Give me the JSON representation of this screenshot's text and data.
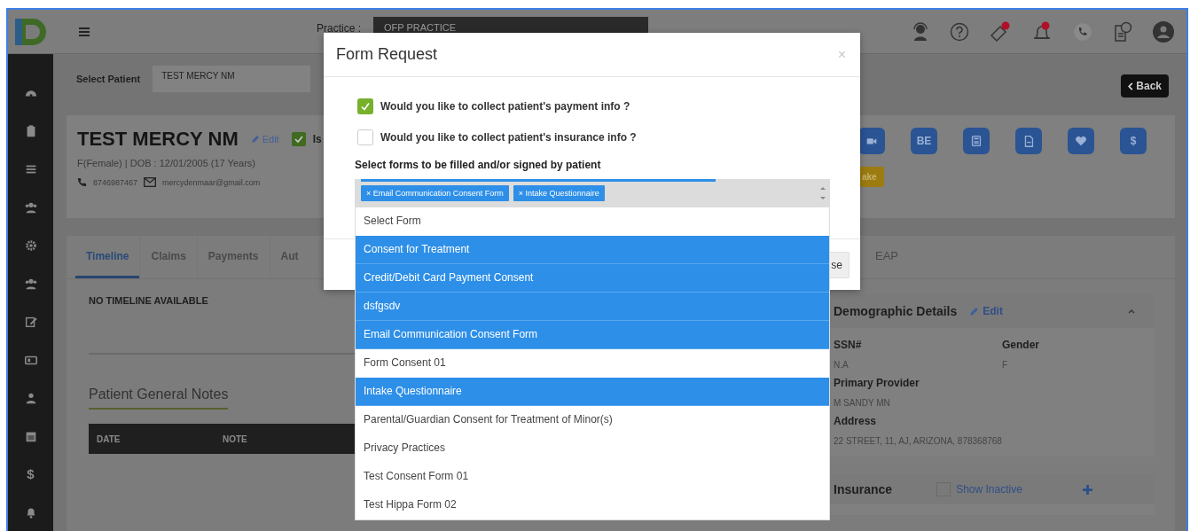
{
  "header": {
    "practice_label": "Practice :",
    "practice_value": "OFP PRACTICE"
  },
  "sidebar": {
    "items": [
      {
        "kind": "dashboard"
      },
      {
        "kind": "clipboard"
      },
      {
        "kind": "list"
      },
      {
        "kind": "users"
      },
      {
        "kind": "settings"
      },
      {
        "kind": "users"
      },
      {
        "kind": "edit"
      },
      {
        "kind": "card"
      },
      {
        "kind": "person"
      },
      {
        "kind": "calendar"
      },
      {
        "kind": "text",
        "label": "$"
      },
      {
        "kind": "bell"
      }
    ]
  },
  "patient_select": {
    "label": "Select Patient",
    "value": "TEST MERCY NM"
  },
  "back_button": "Back",
  "patient": {
    "name": "TEST MERCY NM",
    "edit": "Edit",
    "active_label": "Is",
    "active_checked": true,
    "summary": "F(Female) | DOB : 12/01/2005 (17 Years)",
    "phone": "8746987467",
    "email": "mercydenmaar@gmail.com"
  },
  "action_buttons": [
    {
      "kind": "video"
    },
    {
      "kind": "text",
      "label": "BE"
    },
    {
      "kind": "calculator"
    },
    {
      "kind": "document"
    },
    {
      "kind": "heart"
    },
    {
      "kind": "text",
      "label": "$"
    }
  ],
  "status_button": "ake",
  "tabs": [
    {
      "label": "Timeline",
      "selected": true
    },
    {
      "label": "Claims",
      "selected": false
    },
    {
      "label": "Payments",
      "selected": false
    },
    {
      "label": "Aut",
      "selected": false
    }
  ],
  "right_tab": {
    "label": "EAP",
    "selected": false
  },
  "timeline": {
    "empty_text": "NO TIMELINE AVAILABLE"
  },
  "notes": {
    "title": "Patient General Notes",
    "columns": [
      "DATE",
      "NOTE"
    ]
  },
  "demographics": {
    "title": "Demographic Details",
    "edit": "Edit",
    "expanded": true,
    "fields": [
      {
        "label": "SSN#",
        "value": "N.A"
      },
      {
        "label": "Gender",
        "value": "F"
      },
      {
        "label": "Primary Provider",
        "value": "M SANDY MN"
      },
      {
        "label": "Address",
        "value": "22 STREET, 11, AJ, ARIZONA, 878368768"
      }
    ]
  },
  "insurance": {
    "title": "Insurance",
    "show_inactive": {
      "label": "Show Inactive",
      "checked": false
    }
  },
  "modal": {
    "title": "Form Request",
    "close": "×",
    "questions": [
      {
        "label": "Would you like to collect patient's payment info ?",
        "checked": true
      },
      {
        "label": "Would you like to collect patient's insurance info ?",
        "checked": false
      }
    ],
    "forms_label": "Select forms to be filled and/or signed by patient",
    "tags": [
      {
        "label": "Email Communication Consent Form",
        "remove": "×"
      },
      {
        "label": "Intake Questionnaire",
        "remove": "×"
      }
    ],
    "options": [
      {
        "label": "Select Form",
        "selected": false
      },
      {
        "label": "Consent for Treatment",
        "selected": true
      },
      {
        "label": "Credit/Debit Card Payment Consent",
        "selected": true
      },
      {
        "label": "dsfgsdv",
        "selected": true
      },
      {
        "label": "Email Communication Consent Form",
        "selected": true
      },
      {
        "label": "Form Consent 01",
        "selected": false
      },
      {
        "label": "Intake Questionnaire",
        "selected": true
      },
      {
        "label": "Parental/Guardian Consent for Treatment of Minor(s)",
        "selected": false
      },
      {
        "label": "Privacy Practices",
        "selected": false
      },
      {
        "label": "Test Consent Form 01",
        "selected": false
      },
      {
        "label": "Test Hippa Form 02",
        "selected": false
      }
    ],
    "footer_button": "se"
  }
}
